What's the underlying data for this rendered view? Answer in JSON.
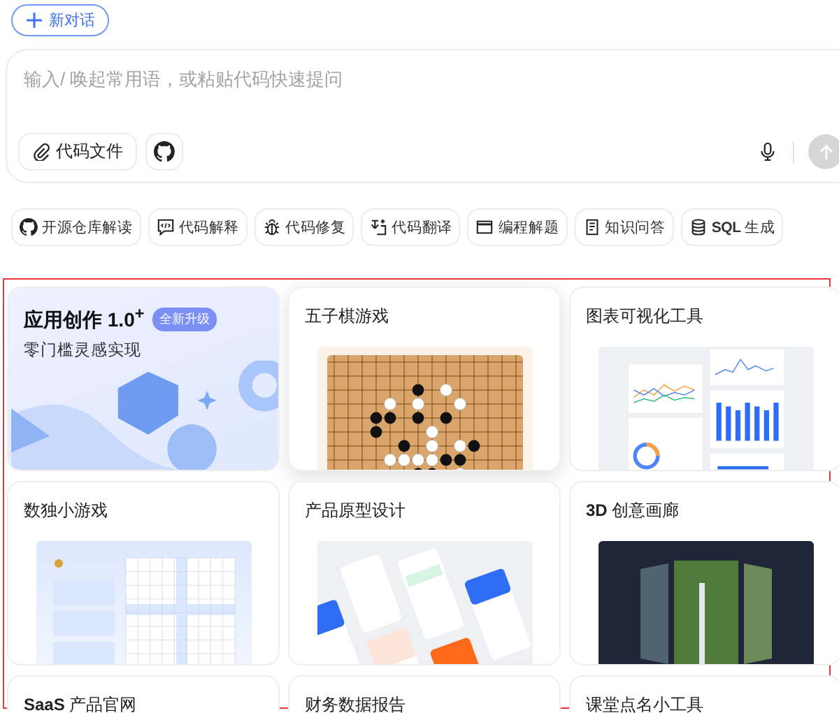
{
  "new_chat": {
    "label": "新对话"
  },
  "composer": {
    "placeholder": "输入/ 唤起常用语，或粘贴代码快速提问",
    "attach_label": "代码文件",
    "send_disabled": true
  },
  "shortcuts": [
    {
      "kind": "github",
      "label": "开源仓库解读"
    },
    {
      "kind": "explain",
      "label": "代码解释"
    },
    {
      "kind": "bug",
      "label": "代码修复"
    },
    {
      "kind": "translate",
      "label": "代码翻译"
    },
    {
      "kind": "window",
      "label": "编程解题"
    },
    {
      "kind": "book",
      "label": "知识问答"
    },
    {
      "kind": "database",
      "label": "**SQL** 生成"
    }
  ],
  "cards": [
    {
      "kind": "banner",
      "title": "应用创作 1.0$^{+}$",
      "badge": "全新升级",
      "subtitle": "零门槛灵感实现",
      "raised": false
    },
    {
      "kind": "gomoku",
      "title": "五子棋游戏",
      "raised": true
    },
    {
      "kind": "chart",
      "title": "图表可视化工具",
      "raised": false
    },
    {
      "kind": "sudoku",
      "title": "数独小游戏",
      "raised": false
    },
    {
      "kind": "prototype",
      "title": "产品原型设计",
      "raised": false
    },
    {
      "kind": "gallery",
      "title": "**3D** 创意画廊",
      "raised": false
    },
    {
      "kind": "plain",
      "title": "**SaaS** 产品官网",
      "raised": false
    },
    {
      "kind": "plain",
      "title": "财务数据报告",
      "raised": false
    },
    {
      "kind": "plain",
      "title": "课堂点名小工具",
      "raised": false
    }
  ]
}
